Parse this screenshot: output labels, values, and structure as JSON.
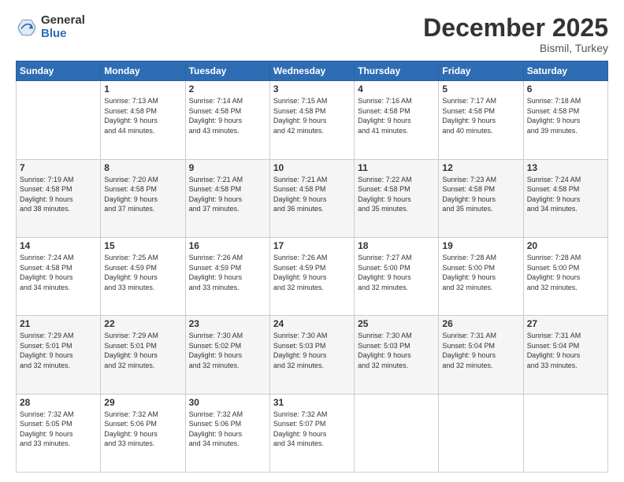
{
  "logo": {
    "general": "General",
    "blue": "Blue"
  },
  "header": {
    "month": "December 2025",
    "location": "Bismil, Turkey"
  },
  "weekdays": [
    "Sunday",
    "Monday",
    "Tuesday",
    "Wednesday",
    "Thursday",
    "Friday",
    "Saturday"
  ],
  "weeks": [
    [
      {
        "day": "",
        "info": ""
      },
      {
        "day": "1",
        "info": "Sunrise: 7:13 AM\nSunset: 4:58 PM\nDaylight: 9 hours\nand 44 minutes."
      },
      {
        "day": "2",
        "info": "Sunrise: 7:14 AM\nSunset: 4:58 PM\nDaylight: 9 hours\nand 43 minutes."
      },
      {
        "day": "3",
        "info": "Sunrise: 7:15 AM\nSunset: 4:58 PM\nDaylight: 9 hours\nand 42 minutes."
      },
      {
        "day": "4",
        "info": "Sunrise: 7:16 AM\nSunset: 4:58 PM\nDaylight: 9 hours\nand 41 minutes."
      },
      {
        "day": "5",
        "info": "Sunrise: 7:17 AM\nSunset: 4:58 PM\nDaylight: 9 hours\nand 40 minutes."
      },
      {
        "day": "6",
        "info": "Sunrise: 7:18 AM\nSunset: 4:58 PM\nDaylight: 9 hours\nand 39 minutes."
      }
    ],
    [
      {
        "day": "7",
        "info": "Sunrise: 7:19 AM\nSunset: 4:58 PM\nDaylight: 9 hours\nand 38 minutes."
      },
      {
        "day": "8",
        "info": "Sunrise: 7:20 AM\nSunset: 4:58 PM\nDaylight: 9 hours\nand 37 minutes."
      },
      {
        "day": "9",
        "info": "Sunrise: 7:21 AM\nSunset: 4:58 PM\nDaylight: 9 hours\nand 37 minutes."
      },
      {
        "day": "10",
        "info": "Sunrise: 7:21 AM\nSunset: 4:58 PM\nDaylight: 9 hours\nand 36 minutes."
      },
      {
        "day": "11",
        "info": "Sunrise: 7:22 AM\nSunset: 4:58 PM\nDaylight: 9 hours\nand 35 minutes."
      },
      {
        "day": "12",
        "info": "Sunrise: 7:23 AM\nSunset: 4:58 PM\nDaylight: 9 hours\nand 35 minutes."
      },
      {
        "day": "13",
        "info": "Sunrise: 7:24 AM\nSunset: 4:58 PM\nDaylight: 9 hours\nand 34 minutes."
      }
    ],
    [
      {
        "day": "14",
        "info": "Sunrise: 7:24 AM\nSunset: 4:58 PM\nDaylight: 9 hours\nand 34 minutes."
      },
      {
        "day": "15",
        "info": "Sunrise: 7:25 AM\nSunset: 4:59 PM\nDaylight: 9 hours\nand 33 minutes."
      },
      {
        "day": "16",
        "info": "Sunrise: 7:26 AM\nSunset: 4:59 PM\nDaylight: 9 hours\nand 33 minutes."
      },
      {
        "day": "17",
        "info": "Sunrise: 7:26 AM\nSunset: 4:59 PM\nDaylight: 9 hours\nand 32 minutes."
      },
      {
        "day": "18",
        "info": "Sunrise: 7:27 AM\nSunset: 5:00 PM\nDaylight: 9 hours\nand 32 minutes."
      },
      {
        "day": "19",
        "info": "Sunrise: 7:28 AM\nSunset: 5:00 PM\nDaylight: 9 hours\nand 32 minutes."
      },
      {
        "day": "20",
        "info": "Sunrise: 7:28 AM\nSunset: 5:00 PM\nDaylight: 9 hours\nand 32 minutes."
      }
    ],
    [
      {
        "day": "21",
        "info": "Sunrise: 7:29 AM\nSunset: 5:01 PM\nDaylight: 9 hours\nand 32 minutes."
      },
      {
        "day": "22",
        "info": "Sunrise: 7:29 AM\nSunset: 5:01 PM\nDaylight: 9 hours\nand 32 minutes."
      },
      {
        "day": "23",
        "info": "Sunrise: 7:30 AM\nSunset: 5:02 PM\nDaylight: 9 hours\nand 32 minutes."
      },
      {
        "day": "24",
        "info": "Sunrise: 7:30 AM\nSunset: 5:03 PM\nDaylight: 9 hours\nand 32 minutes."
      },
      {
        "day": "25",
        "info": "Sunrise: 7:30 AM\nSunset: 5:03 PM\nDaylight: 9 hours\nand 32 minutes."
      },
      {
        "day": "26",
        "info": "Sunrise: 7:31 AM\nSunset: 5:04 PM\nDaylight: 9 hours\nand 32 minutes."
      },
      {
        "day": "27",
        "info": "Sunrise: 7:31 AM\nSunset: 5:04 PM\nDaylight: 9 hours\nand 33 minutes."
      }
    ],
    [
      {
        "day": "28",
        "info": "Sunrise: 7:32 AM\nSunset: 5:05 PM\nDaylight: 9 hours\nand 33 minutes."
      },
      {
        "day": "29",
        "info": "Sunrise: 7:32 AM\nSunset: 5:06 PM\nDaylight: 9 hours\nand 33 minutes."
      },
      {
        "day": "30",
        "info": "Sunrise: 7:32 AM\nSunset: 5:06 PM\nDaylight: 9 hours\nand 34 minutes."
      },
      {
        "day": "31",
        "info": "Sunrise: 7:32 AM\nSunset: 5:07 PM\nDaylight: 9 hours\nand 34 minutes."
      },
      {
        "day": "",
        "info": ""
      },
      {
        "day": "",
        "info": ""
      },
      {
        "day": "",
        "info": ""
      }
    ]
  ]
}
